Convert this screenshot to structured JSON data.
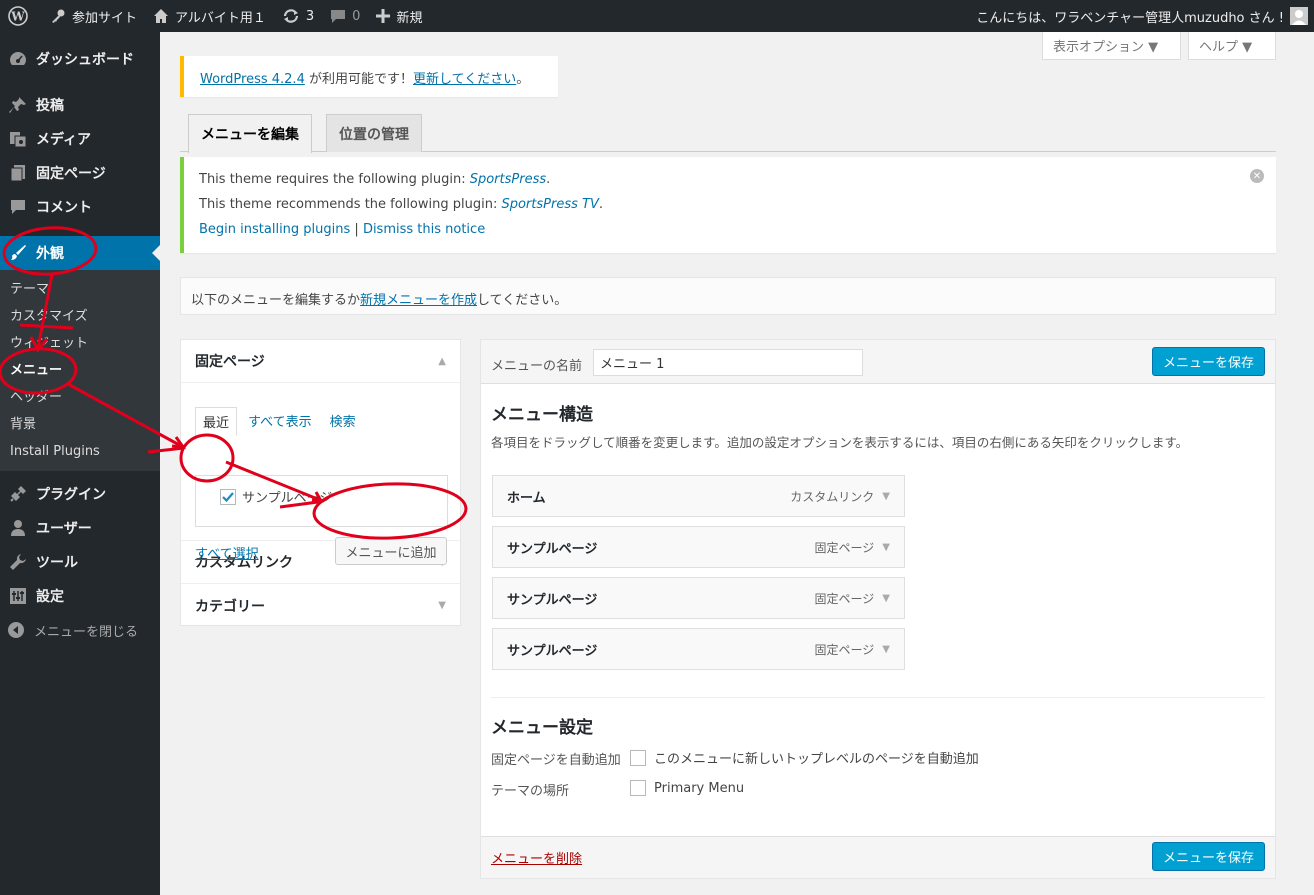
{
  "adminbar": {
    "site": "参加サイト",
    "home": "アルバイト用１",
    "updates": "3",
    "comments": "0",
    "new": "新規",
    "greeting": "こんにちは、ワラベンチャー管理人muzudho さん !"
  },
  "sidebar": {
    "items": [
      {
        "label": "ダッシュボード",
        "icon": "dashboard-icon"
      },
      {
        "label": "投稿",
        "icon": "pushpin-icon"
      },
      {
        "label": "メディア",
        "icon": "media-icon"
      },
      {
        "label": "固定ページ",
        "icon": "pages-icon"
      },
      {
        "label": "コメント",
        "icon": "comment-icon"
      },
      {
        "label": "外観",
        "icon": "brush-icon"
      }
    ],
    "submenu": [
      "テーマ",
      "カスタマイズ",
      "ウィジェット",
      "メニュー",
      "ヘッダー",
      "背景",
      "Install Plugins"
    ],
    "items2": [
      {
        "label": "プラグイン",
        "icon": "plugin-icon"
      },
      {
        "label": "ユーザー",
        "icon": "user-icon"
      },
      {
        "label": "ツール",
        "icon": "wrench-icon"
      },
      {
        "label": "設定",
        "icon": "settings-icon"
      }
    ],
    "collapse": "メニューを閉じる"
  },
  "screen_options": "表示オプション ▼",
  "help": "ヘルプ ▼",
  "update_notice": {
    "link": "WordPress 4.2.4",
    "text": " が利用可能です！",
    "update_link": "更新してください",
    "end": "。"
  },
  "tabs": {
    "edit": "メニューを編集",
    "locations": "位置の管理"
  },
  "plugin_notice": {
    "line1": "This theme requires the following plugin: ",
    "plugin1": "SportsPress",
    "line2": "This theme recommends the following plugin: ",
    "plugin2": "SportsPress TV",
    "begin": "Begin installing plugins",
    "sep": " | ",
    "dismiss": "Dismiss this notice",
    "period": "."
  },
  "manage": {
    "before": "以下のメニューを編集するか",
    "link": "新規メニューを作成",
    "after": "してください。"
  },
  "left": {
    "pages_title": "固定ページ",
    "tabs": [
      "最近",
      "すべて表示",
      "検索"
    ],
    "item": "サンプルページ",
    "select_all": "すべて選択",
    "add_button": "メニューに追加",
    "custom_link": "カスタムリンク",
    "category": "カテゴリー"
  },
  "menu": {
    "name_label": "メニューの名前",
    "name_value": "メニュー 1",
    "save": "メニューを保存",
    "structure_title": "メニュー構造",
    "structure_desc": "各項目をドラッグして順番を変更します。追加の設定オプションを表示するには、項目の右側にある矢印をクリックします。",
    "items": [
      {
        "title": "ホーム",
        "type": "カスタムリンク"
      },
      {
        "title": "サンプルページ",
        "type": "固定ページ"
      },
      {
        "title": "サンプルページ",
        "type": "固定ページ"
      },
      {
        "title": "サンプルページ",
        "type": "固定ページ"
      }
    ],
    "settings_title": "メニュー設定",
    "auto_add_label": "固定ページを自動追加",
    "auto_add_text": "このメニューに新しいトップレベルのページを自動追加",
    "location_label": "テーマの場所",
    "location_text": "Primary Menu",
    "delete": "メニューを削除"
  },
  "colors": {
    "accent": "#0073aa",
    "button": "#00a0d2",
    "annotation": "#e0001b"
  }
}
